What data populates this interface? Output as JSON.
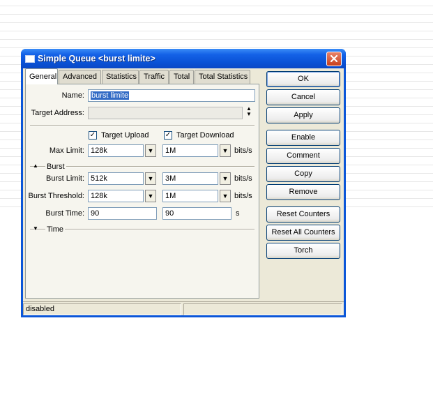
{
  "window": {
    "title": "Simple Queue <burst limite>",
    "close_label": "×"
  },
  "tabs": [
    "General",
    "Advanced",
    "Statistics",
    "Traffic",
    "Total",
    "Total Statistics"
  ],
  "active_tab": "General",
  "form": {
    "name_label": "Name:",
    "name_value": "burst limite",
    "target_address_label": "Target Address:",
    "target_address_value": "",
    "target_upload_label": "Target Upload",
    "target_upload_checked": true,
    "target_download_label": "Target Download",
    "target_download_checked": true,
    "max_limit_label": "Max Limit:",
    "max_limit_upload": "128k",
    "max_limit_download": "1M",
    "burst_section": "Burst",
    "burst_limit_label": "Burst Limit:",
    "burst_limit_upload": "512k",
    "burst_limit_download": "3M",
    "burst_threshold_label": "Burst Threshold:",
    "burst_threshold_upload": "128k",
    "burst_threshold_download": "1M",
    "burst_time_label": "Burst Time:",
    "burst_time_upload": "90",
    "burst_time_download": "90",
    "time_section": "Time",
    "unit_bits": "bits/s",
    "unit_seconds": "s"
  },
  "buttons": {
    "ok": "OK",
    "cancel": "Cancel",
    "apply": "Apply",
    "enable": "Enable",
    "comment": "Comment",
    "copy": "Copy",
    "remove": "Remove",
    "reset_counters": "Reset Counters",
    "reset_all_counters": "Reset All Counters",
    "torch": "Torch"
  },
  "status": {
    "left": "disabled",
    "right": ""
  },
  "icons": {
    "dropdown": "▼",
    "spin_up": "▲",
    "spin_down": "▼",
    "collapse": "▲",
    "expand": "▼",
    "check": "✓"
  }
}
